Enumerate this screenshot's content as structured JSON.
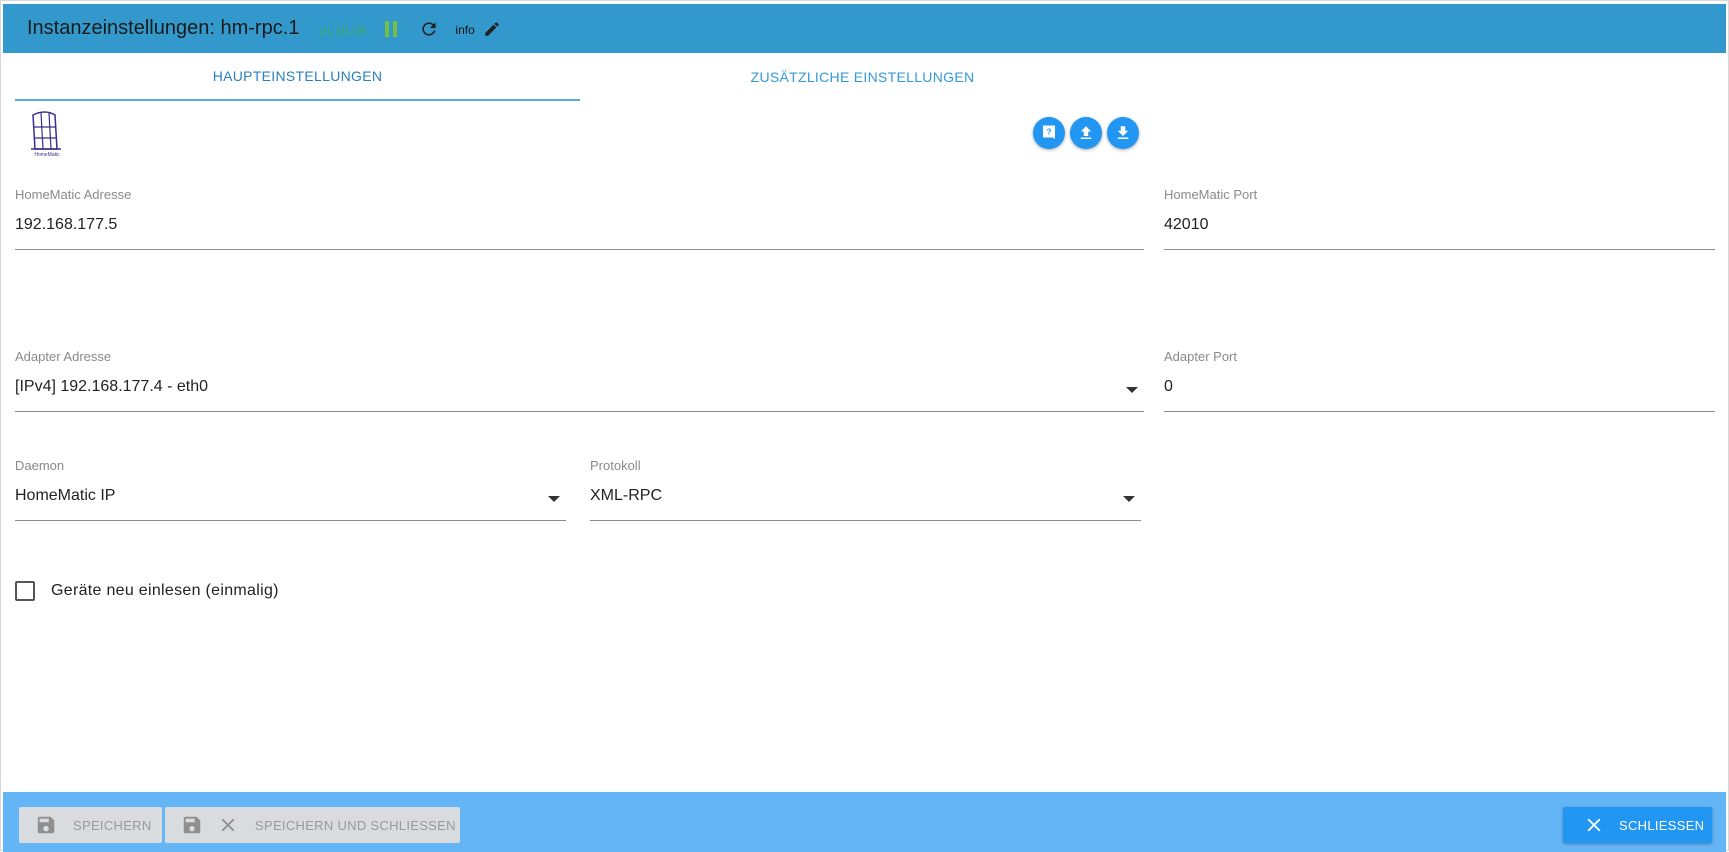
{
  "header": {
    "title": "Instanzeinstellungen: hm-rpc.1",
    "version": "v1.15.19",
    "info_label": "info",
    "bar_color": "#3399cc"
  },
  "tabs": [
    {
      "label": "HAUPTEINSTELLUNGEN",
      "active": true
    },
    {
      "label": "ZUSÄTZLICHE EINSTELLUNGEN",
      "active": false
    }
  ],
  "toolbar": {
    "icons": [
      "help-icon",
      "upload-icon",
      "download-icon"
    ],
    "logo_text": "HomeMatic"
  },
  "fields": {
    "homematic_address": {
      "label": "HomeMatic Adresse",
      "value": "192.168.177.5"
    },
    "homematic_port": {
      "label": "HomeMatic Port",
      "value": "42010"
    },
    "adapter_address": {
      "label": "Adapter Adresse",
      "value": "[IPv4] 192.168.177.4 - eth0"
    },
    "adapter_port": {
      "label": "Adapter Port",
      "value": "0"
    },
    "daemon": {
      "label": "Daemon",
      "value": "HomeMatic IP"
    },
    "protocol": {
      "label": "Protokoll",
      "value": "XML-RPC"
    }
  },
  "checkbox": {
    "label": "Geräte neu einlesen (einmalig)",
    "checked": false
  },
  "footer": {
    "save_label": "SPEICHERN",
    "save_close_label": "SPEICHERN UND SCHLIESSEN",
    "close_label": "SCHLIESSEN",
    "bar_color": "#64b5f6",
    "accent": "#2196f3"
  }
}
